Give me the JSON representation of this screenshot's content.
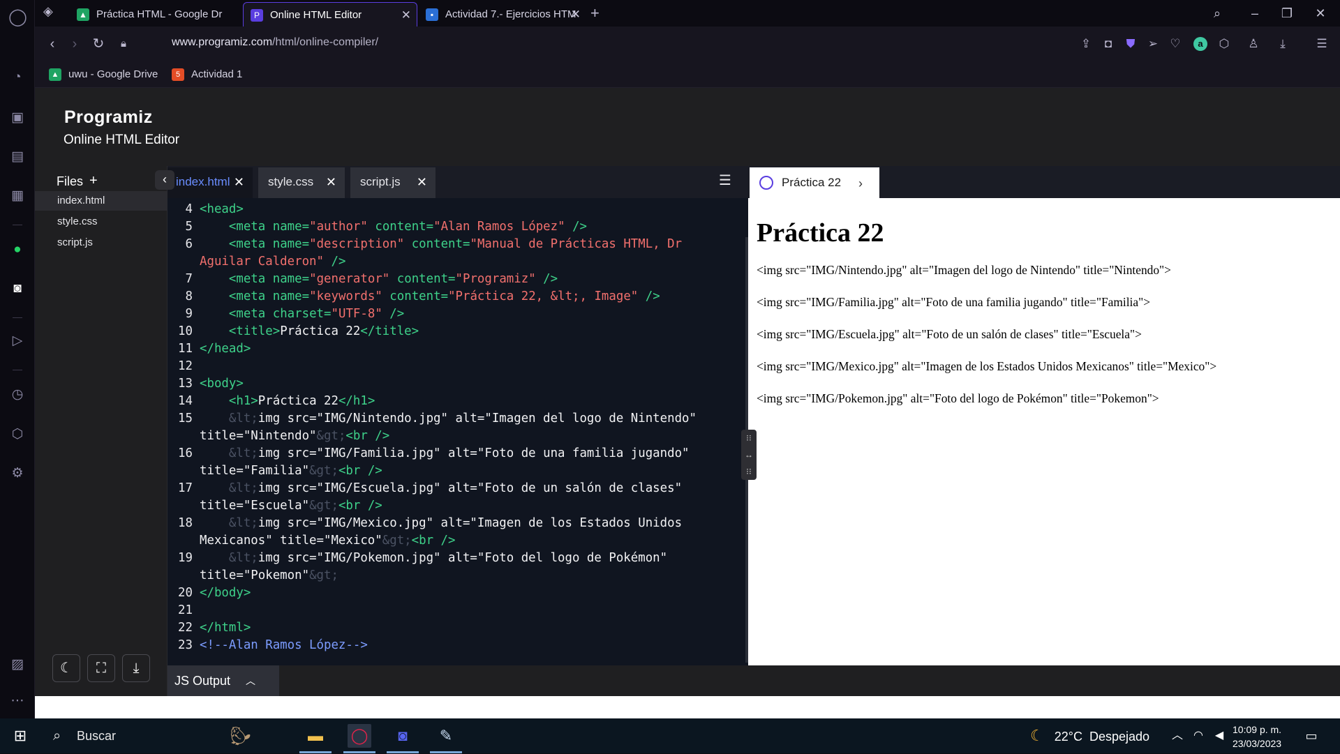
{
  "browser": {
    "tabs": [
      {
        "title": "Práctica HTML - Google Dr",
        "icon": "google-drive-icon"
      },
      {
        "title": "Online HTML Editor",
        "icon": "programiz-icon"
      },
      {
        "title": "Actividad 7.- Ejercicios HTM",
        "icon": "classroom-icon"
      }
    ],
    "url_host": "www.programiz.com",
    "url_path": "/html/online-compiler/",
    "bookmarks": [
      {
        "label": "uwu - Google Drive",
        "icon": "google-drive-icon"
      },
      {
        "label": "Actividad 1",
        "icon": "html5-icon"
      }
    ]
  },
  "header": {
    "logo_text": "Programiz",
    "subtitle": "Online HTML Editor"
  },
  "files": {
    "title": "Files",
    "items": [
      "index.html",
      "style.css",
      "script.js"
    ],
    "active": "index.html"
  },
  "editor": {
    "tabs": [
      "index.html",
      "style.css",
      "script.js"
    ],
    "active_tab": "index.html",
    "lines": [
      {
        "n": "4",
        "html": "<span class=\"tg\">&lt;head&gt;</span>"
      },
      {
        "n": "5",
        "html": "    <span class=\"tg\">&lt;meta</span> <span class=\"at\">name=</span><span class=\"st\">\"author\"</span> <span class=\"at\">content=</span><span class=\"st\">\"Alan Ramos López\"</span> <span class=\"tg\">/&gt;</span>"
      },
      {
        "n": "6",
        "html": "    <span class=\"tg\">&lt;meta</span> <span class=\"at\">name=</span><span class=\"st\">\"description\"</span> <span class=\"at\">content=</span><span class=\"st\">\"Manual de Prácticas HTML, Dr</span>"
      },
      {
        "n": "",
        "html": "<span class=\"st\">Aguilar Calderon\"</span> <span class=\"tg\">/&gt;</span>"
      },
      {
        "n": "7",
        "html": "    <span class=\"tg\">&lt;meta</span> <span class=\"at\">name=</span><span class=\"st\">\"generator\"</span> <span class=\"at\">content=</span><span class=\"st\">\"Programiz\"</span> <span class=\"tg\">/&gt;</span>"
      },
      {
        "n": "8",
        "html": "    <span class=\"tg\">&lt;meta</span> <span class=\"at\">name=</span><span class=\"st\">\"keywords\"</span> <span class=\"at\">content=</span><span class=\"st\">\"Práctica 22, &amp;lt;, Image\"</span> <span class=\"tg\">/&gt;</span>"
      },
      {
        "n": "9",
        "html": "    <span class=\"tg\">&lt;meta</span> <span class=\"at\">charset=</span><span class=\"st\">\"UTF-8\"</span> <span class=\"tg\">/&gt;</span>"
      },
      {
        "n": "10",
        "html": "    <span class=\"tg\">&lt;title&gt;</span><span class=\"tx\">Práctica 22</span><span class=\"tg\">&lt;/title&gt;</span>"
      },
      {
        "n": "11",
        "html": "<span class=\"tg\">&lt;/head&gt;</span>"
      },
      {
        "n": "12",
        "html": ""
      },
      {
        "n": "13",
        "html": "<span class=\"tg\">&lt;body&gt;</span>"
      },
      {
        "n": "14",
        "html": "    <span class=\"tg\">&lt;h1&gt;</span><span class=\"tx\">Práctica 22</span><span class=\"tg\">&lt;/h1&gt;</span>"
      },
      {
        "n": "15",
        "html": "    <span class=\"en\">&amp;lt;</span><span class=\"tx\">img src=\"IMG/Nintendo.jpg\" alt=\"Imagen del logo de Nintendo\"</span>"
      },
      {
        "n": "",
        "html": "<span class=\"tx\">title=\"Nintendo\"</span><span class=\"en\">&amp;gt;</span><span class=\"tg\">&lt;br /&gt;</span>"
      },
      {
        "n": "16",
        "html": "    <span class=\"en\">&amp;lt;</span><span class=\"tx\">img src=\"IMG/Familia.jpg\" alt=\"Foto de una familia jugando\"</span>"
      },
      {
        "n": "",
        "html": "<span class=\"tx\">title=\"Familia\"</span><span class=\"en\">&amp;gt;</span><span class=\"tg\">&lt;br /&gt;</span>"
      },
      {
        "n": "17",
        "html": "    <span class=\"en\">&amp;lt;</span><span class=\"tx\">img src=\"IMG/Escuela.jpg\" alt=\"Foto de un salón de clases\"</span>"
      },
      {
        "n": "",
        "html": "<span class=\"tx\">title=\"Escuela\"</span><span class=\"en\">&amp;gt;</span><span class=\"tg\">&lt;br /&gt;</span>"
      },
      {
        "n": "18",
        "html": "    <span class=\"en\">&amp;lt;</span><span class=\"tx\">img src=\"IMG/Mexico.jpg\" alt=\"Imagen de los Estados Unidos</span>"
      },
      {
        "n": "",
        "html": "<span class=\"tx\">Mexicanos\" title=\"Mexico\"</span><span class=\"en\">&amp;gt;</span><span class=\"tg\">&lt;br /&gt;</span>"
      },
      {
        "n": "19",
        "html": "    <span class=\"en\">&amp;lt;</span><span class=\"tx\">img src=\"IMG/Pokemon.jpg\" alt=\"Foto del logo de Pokémon\"</span>"
      },
      {
        "n": "",
        "html": "<span class=\"tx\">title=\"Pokemon\"</span><span class=\"en\">&amp;gt;</span>"
      },
      {
        "n": "20",
        "html": "<span class=\"tg\">&lt;/body&gt;</span>"
      },
      {
        "n": "21",
        "html": ""
      },
      {
        "n": "22",
        "html": "<span class=\"tg\">&lt;/html&gt;</span>"
      },
      {
        "n": "23",
        "html": "<span class=\"cm\">&lt;!--Alan Ramos López--&gt;</span>"
      }
    ]
  },
  "preview": {
    "tab_title": "Práctica 22",
    "heading": "Práctica 22",
    "paragraphs": [
      "<img src=\"IMG/Nintendo.jpg\" alt=\"Imagen del logo de Nintendo\" title=\"Nintendo\">",
      "<img src=\"IMG/Familia.jpg\" alt=\"Foto de una familia jugando\" title=\"Familia\">",
      "<img src=\"IMG/Escuela.jpg\" alt=\"Foto de un salón de clases\" title=\"Escuela\">",
      "<img src=\"IMG/Mexico.jpg\" alt=\"Imagen de los Estados Unidos Mexicanos\" title=\"Mexico\">",
      "<img src=\"IMG/Pokemon.jpg\" alt=\"Foto del logo de Pokémon\" title=\"Pokemon\">"
    ]
  },
  "js_output": {
    "label": "JS Output"
  },
  "taskbar": {
    "search_label": "Buscar",
    "weather": "22°C  Despejado",
    "time": "10:09 p. m.",
    "date": "23/03/2023"
  },
  "colors": {
    "accent": "#5a3ee0",
    "editor_bg": "#101520",
    "tag_green": "#3ed28a",
    "string_red": "#f2706d"
  }
}
